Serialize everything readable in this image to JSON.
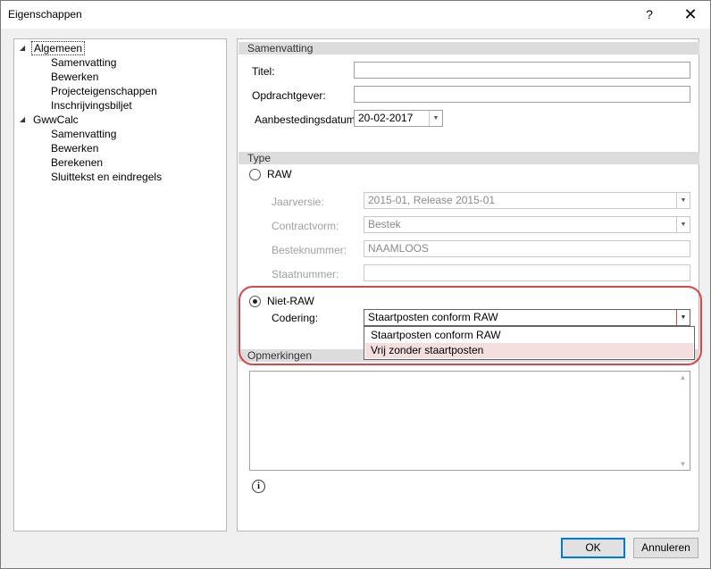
{
  "window": {
    "title": "Eigenschappen",
    "help_label": "?",
    "close_label": "✕"
  },
  "tree": {
    "items": [
      {
        "label": "Algemeen",
        "expanded": true
      },
      {
        "label": "Samenvatting"
      },
      {
        "label": "Bewerken"
      },
      {
        "label": "Projecteigenschappen"
      },
      {
        "label": "Inschrijvingsbiljet"
      },
      {
        "label": "GwwCalc",
        "expanded": true
      },
      {
        "label": "Samenvatting"
      },
      {
        "label": "Bewerken"
      },
      {
        "label": "Berekenen"
      },
      {
        "label": "Sluittekst en eindregels"
      }
    ]
  },
  "summary": {
    "header": "Samenvatting",
    "title_label": "Titel:",
    "title_value": "",
    "client_label": "Opdrachtgever:",
    "client_value": "",
    "tender_date_label": "Aanbestedingsdatum:",
    "tender_date_value": "20-02-2017"
  },
  "type": {
    "header": "Type",
    "raw_label": "RAW",
    "jaarversie_label": "Jaarversie:",
    "jaarversie_value": "2015-01, Release 2015-01",
    "contractvorm_label": "Contractvorm:",
    "contractvorm_value": "Bestek",
    "besteknummer_label": "Besteknummer:",
    "besteknummer_value": "NAAMLOOS",
    "staatnummer_label": "Staatnummer:",
    "staatnummer_value": "",
    "nietraw_label": "Niet-RAW",
    "codering_label": "Codering:",
    "codering_value": "Staartposten conform RAW",
    "codering_options": [
      "Staartposten conform RAW",
      "Vrij zonder staartposten"
    ]
  },
  "remarks": {
    "header": "Opmerkingen",
    "value": ""
  },
  "buttons": {
    "ok": "OK",
    "cancel": "Annuleren"
  },
  "colors": {
    "highlight": "#d9464a",
    "section_header": "#dcdcdc",
    "hover_item": "#f4dede"
  }
}
